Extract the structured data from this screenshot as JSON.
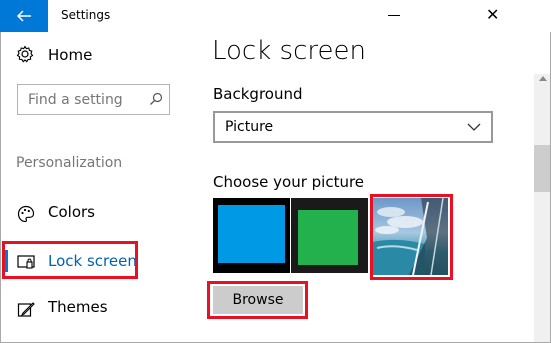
{
  "window": {
    "title": "Settings",
    "accent_color": "#0078d7",
    "highlight_color": "#e81123"
  },
  "sidebar": {
    "home_label": "Home",
    "search_placeholder": "Find a setting",
    "section_label": "Personalization",
    "items": [
      {
        "label": "Colors",
        "icon": "palette-icon"
      },
      {
        "label": "Lock screen",
        "icon": "lock-screen-icon",
        "selected": true
      },
      {
        "label": "Themes",
        "icon": "themes-icon"
      }
    ]
  },
  "main": {
    "title": "Lock screen",
    "background_label": "Background",
    "background_value": "Picture",
    "choose_label": "Choose your picture",
    "pictures": [
      {
        "name": "blue-solid",
        "color": "#0099e6"
      },
      {
        "name": "green-solid",
        "color": "#22b14c"
      },
      {
        "name": "beach-photo",
        "selected_highlight": true
      }
    ],
    "browse_label": "Browse"
  }
}
